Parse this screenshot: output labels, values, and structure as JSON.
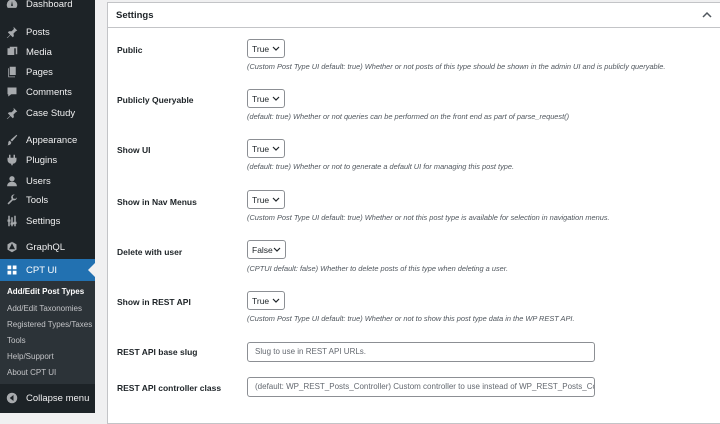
{
  "sidebar": {
    "items": [
      {
        "label": "Dashboard",
        "icon": "dashboard-icon"
      },
      {
        "label": "Posts",
        "icon": "pin-icon"
      },
      {
        "label": "Media",
        "icon": "media-icon"
      },
      {
        "label": "Pages",
        "icon": "pages-icon"
      },
      {
        "label": "Comments",
        "icon": "comments-icon"
      },
      {
        "label": "Case Study",
        "icon": "pin-icon"
      },
      {
        "label": "Appearance",
        "icon": "brush-icon"
      },
      {
        "label": "Plugins",
        "icon": "plugin-icon"
      },
      {
        "label": "Users",
        "icon": "users-icon"
      },
      {
        "label": "Tools",
        "icon": "wrench-icon"
      },
      {
        "label": "Settings",
        "icon": "settings-sliders-icon"
      },
      {
        "label": "GraphQL",
        "icon": "graphql-icon"
      },
      {
        "label": "CPT UI",
        "icon": "cpt-ui-icon"
      }
    ],
    "submenu": [
      "Add/Edit Post Types",
      "Add/Edit Taxonomies",
      "Registered Types/Taxes",
      "Tools",
      "Help/Support",
      "About CPT UI"
    ],
    "collapse_label": "Collapse menu"
  },
  "panel": {
    "title": "Settings",
    "rows": [
      {
        "label": "Public",
        "value": "True",
        "description": "(Custom Post Type UI default: true) Whether or not posts of this type should be shown in the admin UI and is publicly queryable."
      },
      {
        "label": "Publicly Queryable",
        "value": "True",
        "description": "(default: true) Whether or not queries can be performed on the front end as part of parse_request()"
      },
      {
        "label": "Show UI",
        "value": "True",
        "description": "(default: true) Whether or not to generate a default UI for managing this post type."
      },
      {
        "label": "Show in Nav Menus",
        "value": "True",
        "description": "(Custom Post Type UI default: true) Whether or not this post type is available for selection in navigation menus."
      },
      {
        "label": "Delete with user",
        "value": "False",
        "description": "(CPTUI default: false) Whether to delete posts of this type when deleting a user."
      },
      {
        "label": "Show in REST API",
        "value": "True",
        "description": "(Custom Post Type UI default: true) Whether or not to show this post type data in the WP REST API."
      }
    ],
    "rest_base": {
      "label": "REST API base slug",
      "placeholder": "Slug to use in REST API URLs."
    },
    "rest_controller": {
      "label": "REST API controller class",
      "placeholder": "(default: WP_REST_Posts_Controller) Custom controller to use instead of WP_REST_Posts_Controller."
    }
  },
  "colors": {
    "sidebar_bg": "#1d2327",
    "accent": "#2271b1",
    "submenu_bg": "#2c3338"
  }
}
